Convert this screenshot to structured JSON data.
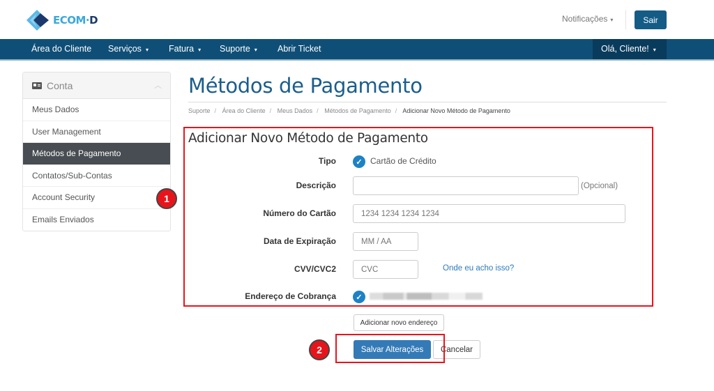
{
  "header": {
    "logo_text": "ECOM·",
    "logo_text_accent": "D",
    "notifications_label": "Notificações",
    "logout_label": "Sair"
  },
  "nav": {
    "items": [
      {
        "label": "Área do Cliente",
        "dropdown": false
      },
      {
        "label": "Serviços",
        "dropdown": true
      },
      {
        "label": "Fatura",
        "dropdown": true
      },
      {
        "label": "Suporte",
        "dropdown": true
      },
      {
        "label": "Abrir Ticket",
        "dropdown": false
      }
    ],
    "user_label": "Olá, Cliente!",
    "caret": "▾"
  },
  "sidebar": {
    "title": "Conta",
    "icon": "id-card-icon",
    "collapse_icon": "chevron-up-icon",
    "items": [
      {
        "label": "Meus Dados",
        "active": false
      },
      {
        "label": "User Management",
        "active": false
      },
      {
        "label": "Métodos de Pagamento",
        "active": true
      },
      {
        "label": "Contatos/Sub-Contas",
        "active": false
      },
      {
        "label": "Account Security",
        "active": false
      },
      {
        "label": "Emails Enviados",
        "active": false
      }
    ]
  },
  "page": {
    "title": "Métodos de Pagamento",
    "breadcrumb": [
      "Suporte",
      "Área do Cliente",
      "Meus Dados",
      "Métodos de Pagamento",
      "Adicionar Novo Método de Pagamento"
    ]
  },
  "form": {
    "title": "Adicionar Novo Método de Pagamento",
    "type_label": "Tipo",
    "type_value": "Cartão de Crédito",
    "description_label": "Descrição",
    "description_value": "",
    "description_hint": "(Opcional)",
    "card_number_label": "Número do Cartão",
    "card_number_placeholder": "1234 1234 1234 1234",
    "expiry_label": "Data de Expiração",
    "expiry_placeholder": "MM / AA",
    "cvv_label": "CVV/CVC2",
    "cvv_placeholder": "CVC",
    "cvv_help_link": "Onde eu acho isso?",
    "billing_label": "Endereço de Cobrança",
    "add_address_button": "Adicionar novo endereço",
    "save_button": "Salvar Alterações",
    "cancel_button": "Cancelar"
  },
  "annotations": {
    "badge1": "1",
    "badge2": "2",
    "color": "#e8141b"
  }
}
